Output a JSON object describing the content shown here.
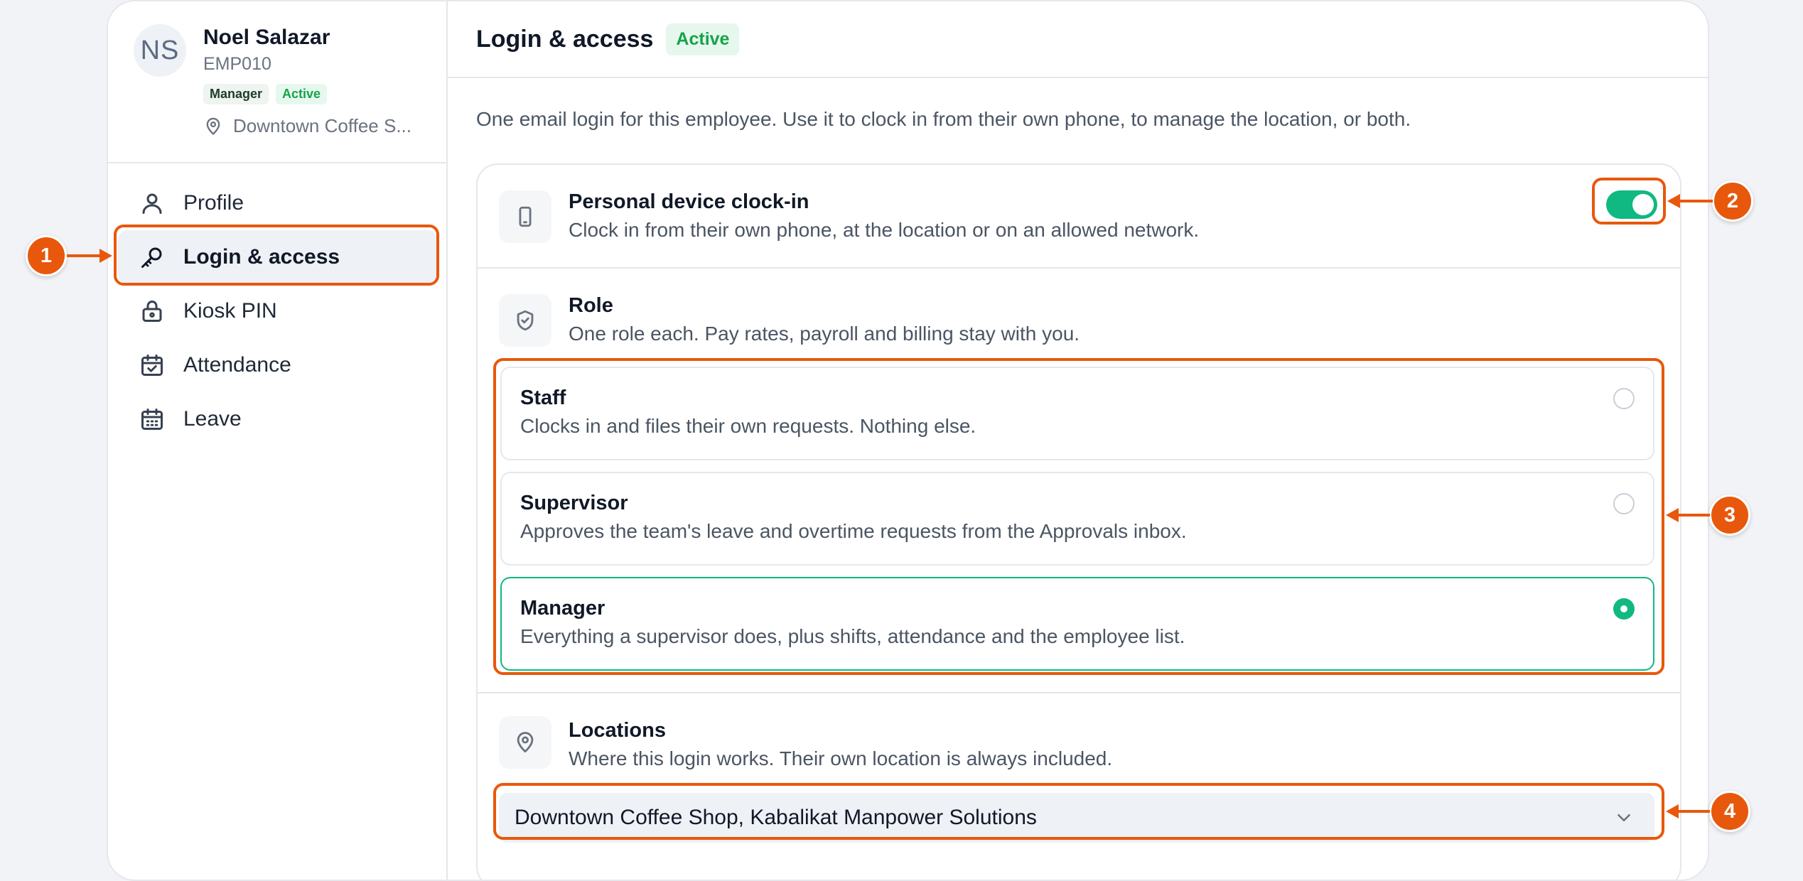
{
  "employee": {
    "initials": "NS",
    "name": "Noel Salazar",
    "id": "EMP010",
    "role_badge": "Manager",
    "status_badge": "Active",
    "location": "Downtown Coffee S..."
  },
  "nav": {
    "items": [
      {
        "label": "Profile",
        "icon": "user-icon"
      },
      {
        "label": "Login & access",
        "icon": "key-icon",
        "active": true
      },
      {
        "label": "Kiosk PIN",
        "icon": "lock-icon"
      },
      {
        "label": "Attendance",
        "icon": "calendar-check-icon"
      },
      {
        "label": "Leave",
        "icon": "calendar-icon"
      }
    ]
  },
  "header": {
    "title": "Login & access",
    "status": "Active"
  },
  "intro": "One email login for this employee. Use it to clock in from their own phone, to manage the location, or both.",
  "device": {
    "title": "Personal device clock-in",
    "description": "Clock in from their own phone, at the location or on an allowed network.",
    "enabled": true
  },
  "role": {
    "title": "Role",
    "description": "One role each. Pay rates, payroll and billing stay with you.",
    "options": [
      {
        "title": "Staff",
        "description": "Clocks in and files their own requests. Nothing else.",
        "selected": false
      },
      {
        "title": "Supervisor",
        "description": "Approves the team's leave and overtime requests from the Approvals inbox.",
        "selected": false
      },
      {
        "title": "Manager",
        "description": "Everything a supervisor does, plus shifts, attendance and the employee list.",
        "selected": true
      }
    ]
  },
  "locations": {
    "title": "Locations",
    "description": "Where this login works. Their own location is always included.",
    "selected_value": "Downtown Coffee Shop, Kabalikat Manpower Solutions"
  },
  "annotations": [
    "1",
    "2",
    "3",
    "4"
  ],
  "colors": {
    "accent": "#10b981",
    "annotation": "#e8580c",
    "active_badge_text": "#16a34a"
  }
}
